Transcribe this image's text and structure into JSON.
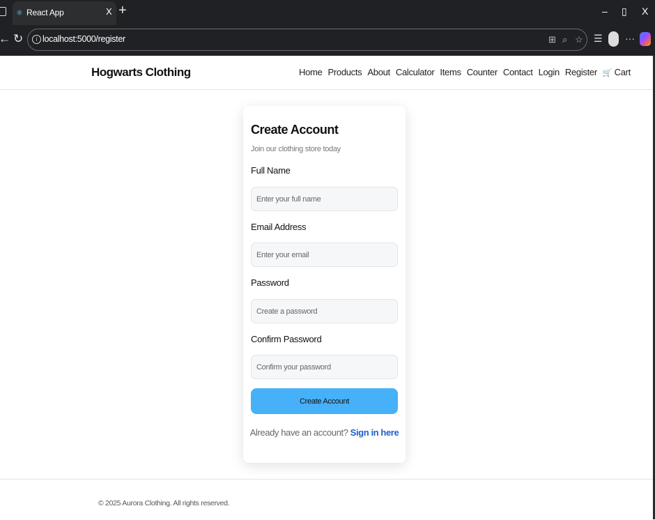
{
  "browser": {
    "tab_title": "React App",
    "tab_close": "X",
    "new_tab": "+",
    "url": "localhost:5000/register",
    "window_controls": [
      "–",
      "▯",
      "X"
    ],
    "more_menu": "···"
  },
  "header": {
    "brand": "Hogwarts Clothing",
    "nav": [
      "Home",
      "Products",
      "About",
      "Calculator",
      "Items",
      "Counter",
      "Contact",
      "Login",
      "Register"
    ],
    "cart_icon": "🛒",
    "cart_label": "Cart"
  },
  "form": {
    "title": "Create Account",
    "subtitle": "Join our clothing store today",
    "fields": [
      {
        "label": "Full Name",
        "placeholder": "Enter your full name",
        "value": ""
      },
      {
        "label": "Email Address",
        "placeholder": "Enter your email",
        "value": ""
      },
      {
        "label": "Password",
        "placeholder": "Create a password",
        "value": ""
      },
      {
        "label": "Confirm Password",
        "placeholder": "Confirm your password",
        "value": ""
      }
    ],
    "submit_label": "Create Account",
    "signin_prompt": "Already have an account?",
    "signin_link": "Sign in here"
  },
  "footer": {
    "text": "© 2025 Aurora Clothing. All rights reserved."
  },
  "colors": {
    "primary_button": "#46b0f8",
    "link": "#1f5fcc",
    "chrome_bg": "#202124"
  }
}
